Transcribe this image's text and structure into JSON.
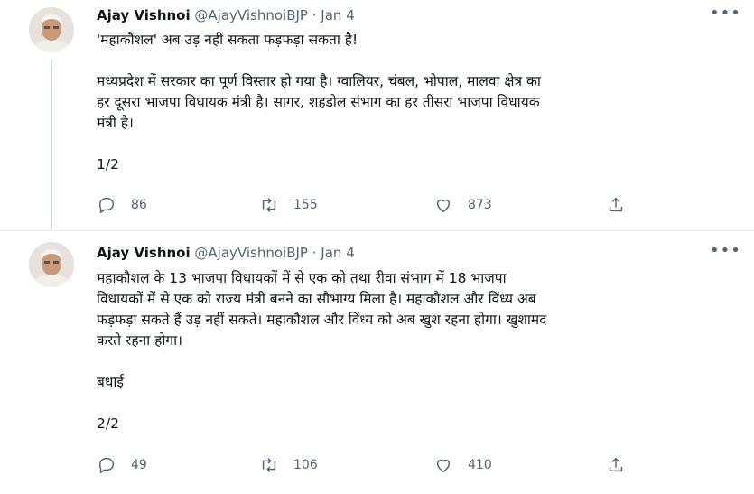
{
  "tweets": [
    {
      "author_name": "Ajay Vishnoi",
      "handle": "@AjayVishnoiBJP",
      "separator": "·",
      "date": "Jan 4",
      "more_icon": "more-horizontal-icon",
      "text": "'महाकौशल' अब उड़ नहीं सकता फड़फड़ा सकता है!\n\nमध्यप्रदेश में सरकार का पूर्ण विस्तार हो गया है। ग्वालियर, चंबल, भोपाल, मालवा क्षेत्र का\nहर दूसरा भाजपा विधायक मंत्री है। सागर, शहडोल संभाग का हर तीसरा भाजपा विधायक\nमंत्री है।\n\n1/2",
      "reply_count": "86",
      "retweet_count": "155",
      "like_count": "873"
    },
    {
      "author_name": "Ajay Vishnoi",
      "handle": "@AjayVishnoiBJP",
      "separator": "·",
      "date": "Jan 4",
      "more_icon": "more-horizontal-icon",
      "text": "महाकौशल के 13 भाजपा विधायकों में से एक को तथा रीवा संभाग में 18 भाजपा\nविधायकों में से एक को राज्य मंत्री बनने का सौभाग्य मिला है। महाकौशल और विंध्य अब\nफड़फड़ा सकते हैं उड़ नहीं सकते। महाकौशल और विंध्य को अब खुश रहना होगा। खुशामद\nकरते रहना होगा।\n\nबधाई\n\n2/2",
      "reply_count": "49",
      "retweet_count": "106",
      "like_count": "410"
    }
  ],
  "colors": {
    "text_primary": "#0f1419",
    "text_secondary": "#536471",
    "divider": "#e6ecf0",
    "thread_line": "#cfd9de"
  }
}
